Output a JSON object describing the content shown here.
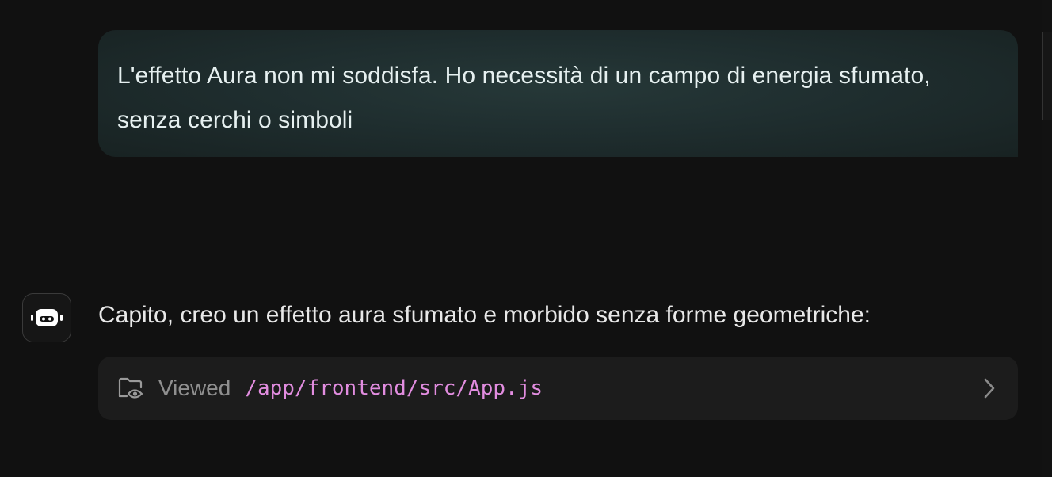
{
  "conversation": {
    "user_message": "L'effetto Aura non mi soddisfa. Ho necessità di un campo di energia sfumato, senza cerchi o simboli",
    "assistant_message": "Capito, creo un effetto aura sfumato e morbido senza forme geometriche:",
    "assistant_avatar_icon": "robot-icon"
  },
  "tool_call": {
    "action_label": "Viewed",
    "path": "/app/frontend/src/App.js",
    "icon": "folder-eye-icon",
    "expand_icon": "chevron-right-icon"
  },
  "colors": {
    "background": "#111111",
    "user_bubble": "#1f2e2f",
    "file_row": "#1c1c1c",
    "path_accent": "#e28de0"
  }
}
